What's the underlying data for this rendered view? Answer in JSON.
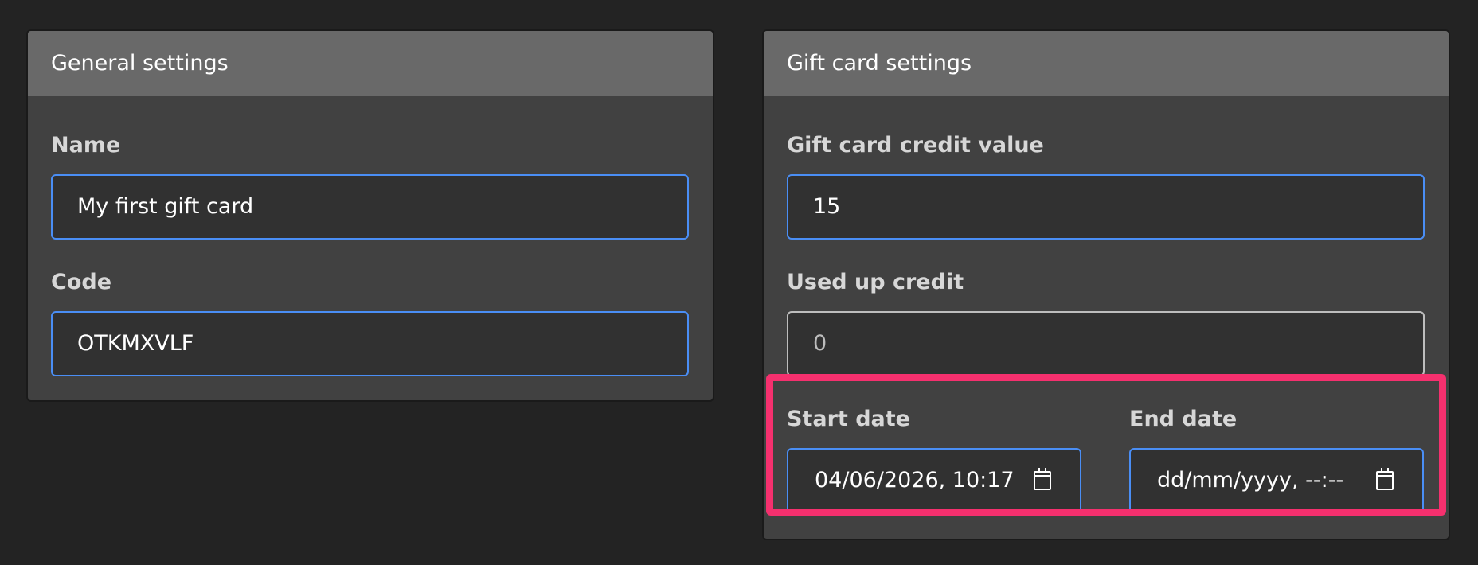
{
  "general": {
    "header": "General settings",
    "name_label": "Name",
    "name_value": "My first gift card",
    "code_label": "Code",
    "code_value": "OTKMXVLF"
  },
  "gift": {
    "header": "Gift card settings",
    "credit_label": "Gift card credit value",
    "credit_value": "15",
    "used_label": "Used up credit",
    "used_value": "0",
    "start_label": "Start date",
    "start_value": "04/06/2026, 10:17",
    "end_label": "End date",
    "end_placeholder": "dd/mm/yyyy, --:--"
  },
  "colors": {
    "background": "#232323",
    "panel": "#414141",
    "panel_header": "#696969",
    "input_bg": "#313131",
    "focus_border": "#4a8ef5",
    "highlight": "#f5306e"
  },
  "icons": [
    "calendar-icon"
  ]
}
